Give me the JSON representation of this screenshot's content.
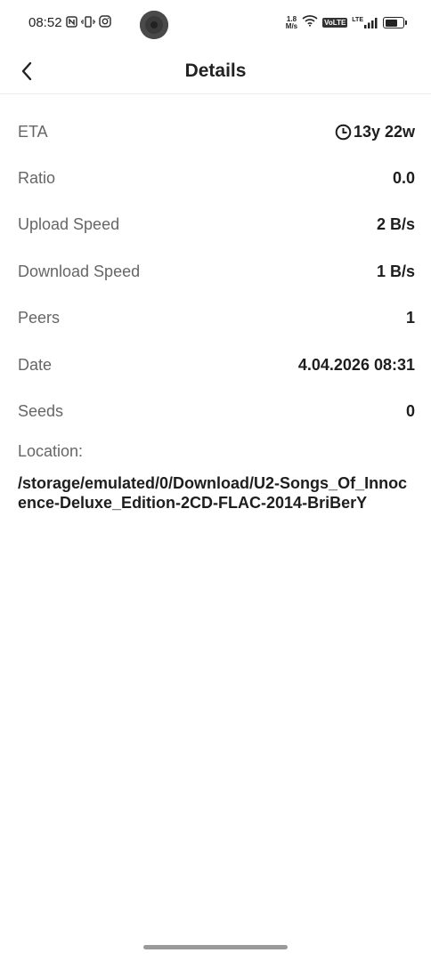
{
  "status_bar": {
    "time": "08:52",
    "net_speed_value": "1.8",
    "net_speed_unit": "M/s",
    "volte_badge": "VoLTE",
    "lte_label": "LTE",
    "left_icons": [
      "nfc-icon",
      "vibrate-icon",
      "instagram-icon"
    ],
    "right_icons": [
      "wifi-icon",
      "signal-icon",
      "battery-icon"
    ]
  },
  "header": {
    "title": "Details",
    "back_icon": "chevron-left-icon"
  },
  "details": {
    "eta_label": "ETA",
    "eta_value": "13y 22w",
    "eta_icon": "clock-icon",
    "ratio_label": "Ratio",
    "ratio_value": "0.0",
    "upload_label": "Upload Speed",
    "upload_value": "2 B/s",
    "download_label": "Download Speed",
    "download_value": "1 B/s",
    "peers_label": "Peers",
    "peers_value": "1",
    "date_label": "Date",
    "date_value": "4.04.2026 08:31",
    "seeds_label": "Seeds",
    "seeds_value": "0",
    "location_label": "Location:",
    "location_value": "/storage/emulated/0/Download/U2-Songs_Of_Innocence-Deluxe_Edition-2CD-FLAC-2014-BriBerY"
  }
}
